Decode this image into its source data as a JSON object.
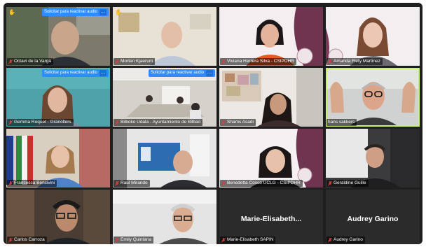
{
  "banner_label": "Solicitar para reactivar audio",
  "banner_more": "…",
  "hand_glyph": "✋",
  "tiles": [
    {
      "name": "Octavi de la Varga"
    },
    {
      "name": "Morten Kjaerum"
    },
    {
      "name": "Viviana Herrera Silva - CSIPDHR"
    },
    {
      "name": "Amanda Flety Martinez"
    },
    {
      "name": "Gemma Roquet - Granollers"
    },
    {
      "name": "Bilboko Udala - Ayuntamiento de Bilbao"
    },
    {
      "name": "Shams Asadi"
    },
    {
      "name": "hans sakkers"
    },
    {
      "name": "Francesca Bencivini"
    },
    {
      "name": "Raul Mirando"
    },
    {
      "name": "Benedetta Cosco UCLG - CSIPDHR"
    },
    {
      "name": "Geraldine Guille"
    },
    {
      "name": "Carlos Carroza"
    },
    {
      "name": "Emily Quintana"
    },
    {
      "name": "Marie-Elisabeth SAPIN",
      "big": "Marie-Elisabeth..."
    },
    {
      "name": "Audrey Garino",
      "big": "Audrey Garino"
    }
  ],
  "colors": {
    "active_speaker": "#c7f56a",
    "banner": "#2d8cff",
    "muted_mic": "#e03b3b"
  }
}
